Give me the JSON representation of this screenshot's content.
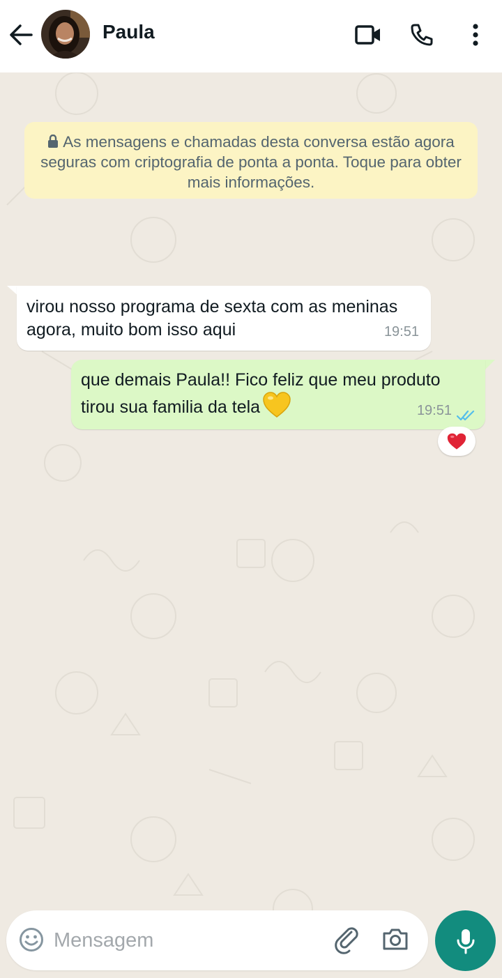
{
  "header": {
    "contact_name": "Paula"
  },
  "icons": {
    "back": "arrow-back-icon",
    "video": "video-call-icon",
    "call": "phone-icon",
    "menu": "more-vertical-icon",
    "lock": "lock-icon",
    "emoji": "emoji-icon",
    "attach": "paperclip-icon",
    "camera": "camera-icon",
    "mic": "microphone-icon"
  },
  "notice": {
    "text": "As mensagens e chamadas desta conversa estão agora seguras com criptografia de ponta a ponta. Toque para obter mais informações."
  },
  "messages": [
    {
      "direction": "incoming",
      "text": "virou nosso programa de sexta com as meninas agora, muito bom isso aqui",
      "time": "19:51"
    },
    {
      "direction": "outgoing",
      "text": "que demais Paula!! Fico feliz que meu produto tirou sua familia da tela",
      "emoji": "yellow-heart",
      "time": "19:51",
      "status": "read",
      "reaction": "red-heart"
    }
  ],
  "composer": {
    "placeholder": "Mensagem"
  },
  "colors": {
    "background": "#efeae2",
    "incoming_bubble": "#ffffff",
    "outgoing_bubble": "#dcf8c6",
    "notice_bg": "#fcf4c4",
    "accent": "#128c7e",
    "read_ticks": "#53bdeb"
  }
}
